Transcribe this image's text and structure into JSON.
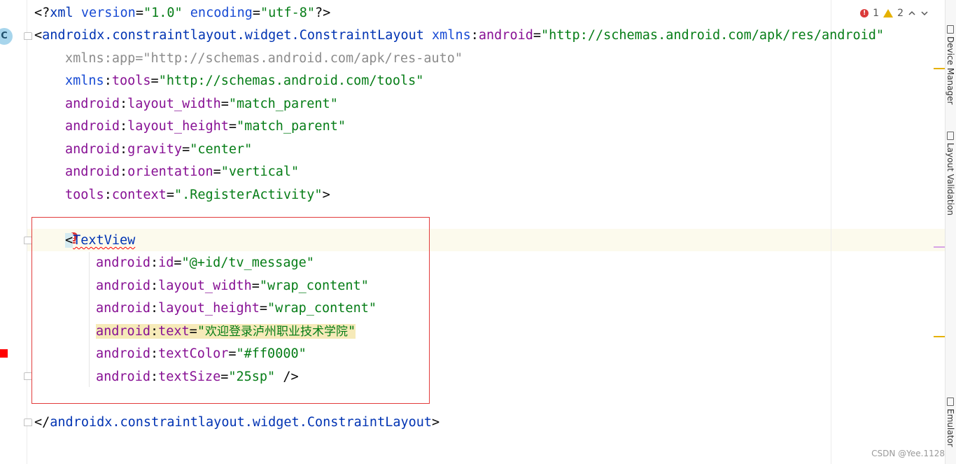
{
  "editor": {
    "lines": {
      "l1": {
        "open": "<?",
        "xml": "xml",
        "sp1": " ",
        "version_attr": "version",
        "eq1": "=",
        "version_val": "\"1.0\"",
        "sp2": " ",
        "enc_attr": "encoding",
        "eq2": "=",
        "enc_val": "\"utf-8\"",
        "close": "?>"
      },
      "l2": {
        "lt": "<",
        "tag": "androidx.constraintlayout.widget.ConstraintLayout",
        "sp": " ",
        "ns": "xmlns",
        "colon": ":",
        "attr": "android",
        "eq": "=",
        "val": "\"http://schemas.android.com/apk/res/android\""
      },
      "l3": {
        "text": "xmlns:app=\"http://schemas.android.com/apk/res-auto\""
      },
      "l4": {
        "ns": "xmlns",
        "colon": ":",
        "attr": "tools",
        "eq": "=",
        "val": "\"http://schemas.android.com/tools\""
      },
      "l5": {
        "ns": "android",
        "colon": ":",
        "attr": "layout_width",
        "eq": "=",
        "val": "\"match_parent\""
      },
      "l6": {
        "ns": "android",
        "colon": ":",
        "attr": "layout_height",
        "eq": "=",
        "val": "\"match_parent\""
      },
      "l7": {
        "ns": "android",
        "colon": ":",
        "attr": "gravity",
        "eq": "=",
        "val": "\"center\""
      },
      "l8": {
        "ns": "android",
        "colon": ":",
        "attr": "orientation",
        "eq": "=",
        "val": "\"vertical\""
      },
      "l9": {
        "ns": "tools",
        "colon": ":",
        "attr": "context",
        "eq": "=",
        "val": "\".RegisterActivity\"",
        "gt": ">"
      },
      "l10": {
        "lt": "<",
        "tag": "TextView"
      },
      "l11": {
        "ns": "android",
        "colon": ":",
        "attr": "id",
        "eq": "=",
        "val": "\"@+id/tv_message\""
      },
      "l12": {
        "ns": "android",
        "colon": ":",
        "attr": "layout_width",
        "eq": "=",
        "val": "\"wrap_content\""
      },
      "l13": {
        "ns": "android",
        "colon": ":",
        "attr": "layout_height",
        "eq": "=",
        "val": "\"wrap_content\""
      },
      "l14": {
        "ns": "android",
        "colon": ":",
        "attr": "text",
        "eq": "=",
        "q1": "\"",
        "cn": "欢迎登录泸州职业技术学院",
        "q2": "\""
      },
      "l15": {
        "ns": "android",
        "colon": ":",
        "attr": "textColor",
        "eq": "=",
        "val": "\"#ff0000\""
      },
      "l16": {
        "ns": "android",
        "colon": ":",
        "attr": "textSize",
        "eq": "=",
        "val": "\"25sp\"",
        "close": " />"
      },
      "l17": {
        "lt": "</",
        "tag": "androidx.constraintlayout.widget.ConstraintLayout",
        "gt": ">"
      }
    }
  },
  "inspections": {
    "errors": "1",
    "warnings": "2",
    "up_icon": "chevron-up-icon",
    "down_icon": "chevron-down-icon"
  },
  "gutter": {
    "class_badge": "C"
  },
  "side_tabs": {
    "device_manager": "Device Manager",
    "layout_validation": "Layout Validation",
    "emulator": "Emulator"
  },
  "watermark": "CSDN @Yee.1128",
  "colors": {
    "tag": "#0033b3",
    "attribute": "#871094",
    "namespace": "#174ad4",
    "value": "#067d17",
    "annotation_box": "#e23b3b",
    "error": "#db3a3a",
    "warning": "#e5b100"
  }
}
